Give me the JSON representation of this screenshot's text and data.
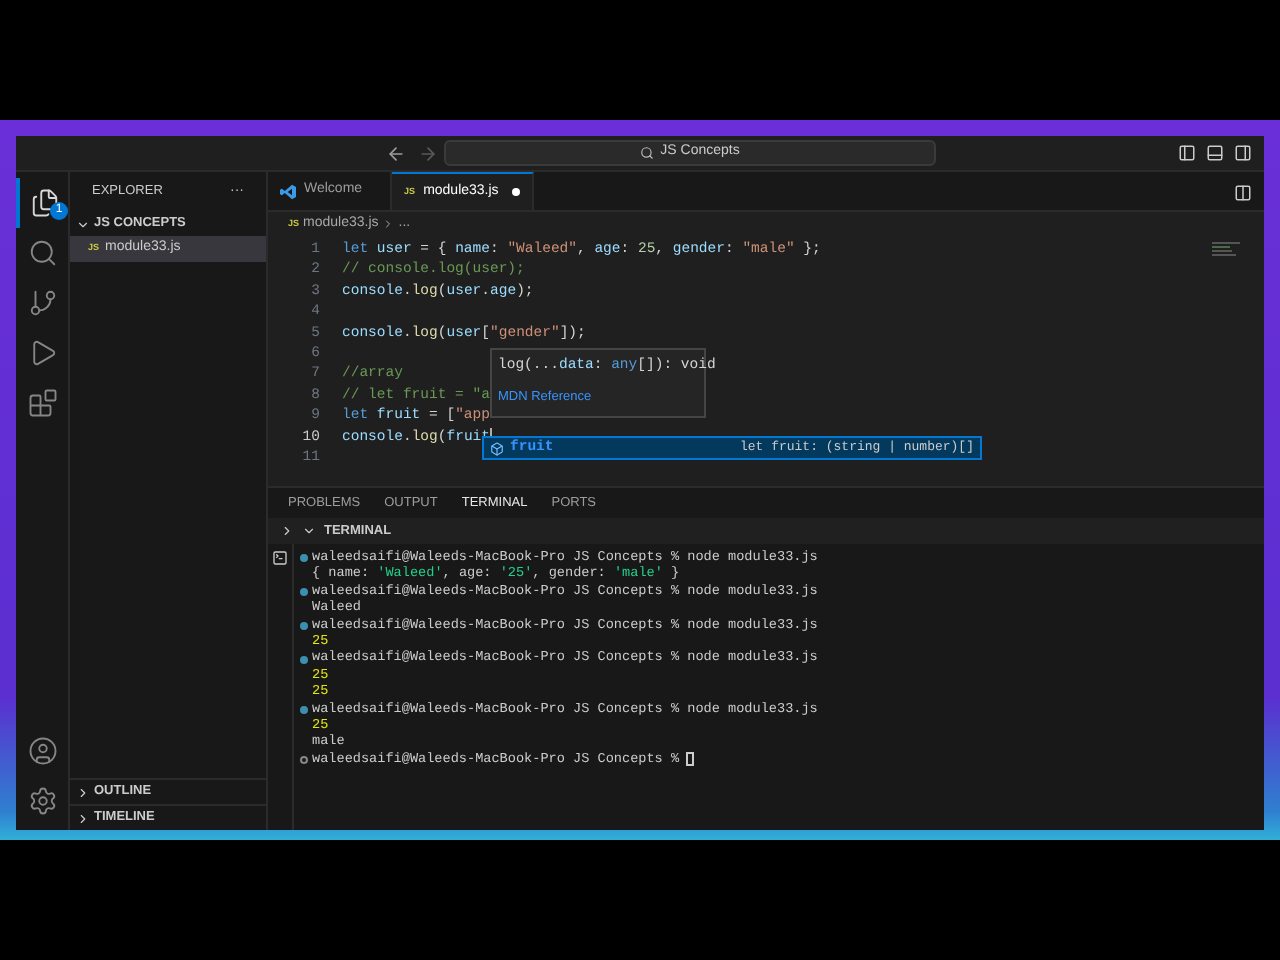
{
  "title_bar": {
    "search": "JS Concepts"
  },
  "activity_bar": {
    "badge": "1"
  },
  "sidebar": {
    "title": "EXPLORER",
    "more": "···",
    "folder": {
      "name": "JS CONCEPTS",
      "expanded": true,
      "files": [
        {
          "name": "module33.js",
          "badge": "JS",
          "selected": true
        }
      ]
    },
    "sections": [
      {
        "name": "OUTLINE",
        "expanded": false
      },
      {
        "name": "TIMELINE",
        "expanded": false
      }
    ]
  },
  "tabs": [
    {
      "label": "Welcome",
      "kind": "welcome",
      "selected": false,
      "modified": false
    },
    {
      "label": "module33.js",
      "kind": "js",
      "badge": "JS",
      "selected": true,
      "modified": true
    }
  ],
  "breadcrumb": {
    "badge": "JS",
    "file": "module33.js",
    "rest": "..."
  },
  "editor": {
    "lines": [
      {
        "number": "1",
        "current": false,
        "tokens": [
          {
            "text": "let ",
            "kind": "keyword"
          },
          {
            "text": "user",
            "kind": "variable"
          },
          {
            "text": " = { ",
            "kind": "plain"
          },
          {
            "text": "name",
            "kind": "property"
          },
          {
            "text": ": ",
            "kind": "plain"
          },
          {
            "text": "\"Waleed\"",
            "kind": "string"
          },
          {
            "text": ", ",
            "kind": "plain"
          },
          {
            "text": "age",
            "kind": "property"
          },
          {
            "text": ": ",
            "kind": "plain"
          },
          {
            "text": "25",
            "kind": "number"
          },
          {
            "text": ", ",
            "kind": "plain"
          },
          {
            "text": "gender",
            "kind": "property"
          },
          {
            "text": ": ",
            "kind": "plain"
          },
          {
            "text": "\"male\"",
            "kind": "string"
          },
          {
            "text": " };",
            "kind": "plain"
          }
        ]
      },
      {
        "number": "2",
        "current": false,
        "tokens": [
          {
            "text": "// console.log(user);",
            "kind": "comment"
          }
        ]
      },
      {
        "number": "3",
        "current": false,
        "tokens": [
          {
            "text": "console",
            "kind": "variable"
          },
          {
            "text": ".",
            "kind": "plain"
          },
          {
            "text": "log",
            "kind": "function"
          },
          {
            "text": "(",
            "kind": "plain"
          },
          {
            "text": "user",
            "kind": "variable"
          },
          {
            "text": ".",
            "kind": "plain"
          },
          {
            "text": "age",
            "kind": "property"
          },
          {
            "text": ");",
            "kind": "plain"
          }
        ]
      },
      {
        "number": "4",
        "current": false
      },
      {
        "number": "5",
        "current": false,
        "tokens": [
          {
            "text": "console",
            "kind": "variable"
          },
          {
            "text": ".",
            "kind": "plain"
          },
          {
            "text": "log",
            "kind": "function"
          },
          {
            "text": "(",
            "kind": "plain"
          },
          {
            "text": "user",
            "kind": "variable"
          },
          {
            "text": "[",
            "kind": "plain"
          },
          {
            "text": "\"gender\"",
            "kind": "string"
          },
          {
            "text": "]);",
            "kind": "plain"
          }
        ]
      },
      {
        "number": "6",
        "current": false
      },
      {
        "number": "7",
        "current": false,
        "tokens": [
          {
            "text": "//array",
            "kind": "comment"
          }
        ]
      },
      {
        "number": "8",
        "current": false,
        "tokens": [
          {
            "text": "// let fruit = \"a",
            "kind": "comment"
          }
        ]
      },
      {
        "number": "9",
        "current": false,
        "tokens": [
          {
            "text": "let ",
            "kind": "keyword"
          },
          {
            "text": "fruit",
            "kind": "variable"
          },
          {
            "text": " = [",
            "kind": "plain"
          },
          {
            "text": "\"app",
            "kind": "string"
          }
        ]
      },
      {
        "number": "10",
        "current": true,
        "tokens": [
          {
            "text": "console",
            "kind": "variable"
          },
          {
            "text": ".",
            "kind": "plain"
          },
          {
            "text": "log",
            "kind": "function"
          },
          {
            "text": "(",
            "kind": "plain"
          },
          {
            "text": "fruit",
            "kind": "variable"
          }
        ],
        "cursor": true
      },
      {
        "number": "11",
        "current": false
      }
    ]
  },
  "hover": {
    "signature": [
      {
        "text": "log(...",
        "kind": "plain"
      },
      {
        "text": "data",
        "kind": "variable"
      },
      {
        "text": ": ",
        "kind": "plain"
      },
      {
        "text": "any",
        "kind": "keyword"
      },
      {
        "text": "[]): void",
        "kind": "plain"
      }
    ],
    "link": "MDN Reference"
  },
  "suggestion": {
    "label": "fruit",
    "detail": "let fruit: (string | number)[]",
    "selected": true
  },
  "panel": {
    "tabs": [
      {
        "label": "PROBLEMS",
        "selected": false
      },
      {
        "label": "OUTPUT",
        "selected": false
      },
      {
        "label": "TERMINAL",
        "selected": true
      },
      {
        "label": "PORTS",
        "selected": false
      }
    ],
    "section": {
      "name": "TERMINAL",
      "expanded": true
    },
    "terminal_lines": [
      {
        "kind": "prompt",
        "text": "waleedsaifi@Waleeds-MacBook-Pro JS Concepts % node module33.js",
        "completed": true
      },
      {
        "kind": "output",
        "tokens": [
          {
            "text": "{ name: ",
            "kind": "plain"
          },
          {
            "text": "'Waleed'",
            "kind": "string"
          },
          {
            "text": ", age: ",
            "kind": "plain"
          },
          {
            "text": "'25'",
            "kind": "string"
          },
          {
            "text": ", gender: ",
            "kind": "plain"
          },
          {
            "text": "'male'",
            "kind": "string"
          },
          {
            "text": " }",
            "kind": "plain"
          }
        ]
      },
      {
        "kind": "prompt",
        "text": "waleedsaifi@Waleeds-MacBook-Pro JS Concepts % node module33.js",
        "completed": true
      },
      {
        "kind": "output",
        "tokens": [
          {
            "text": "Waleed",
            "kind": "plain"
          }
        ]
      },
      {
        "kind": "prompt",
        "text": "waleedsaifi@Waleeds-MacBook-Pro JS Concepts % node module33.js",
        "completed": true
      },
      {
        "kind": "output",
        "tokens": [
          {
            "text": "25",
            "kind": "number"
          }
        ]
      },
      {
        "kind": "prompt",
        "text": "waleedsaifi@Waleeds-MacBook-Pro JS Concepts % node module33.js",
        "completed": true
      },
      {
        "kind": "output",
        "tokens": [
          {
            "text": "25",
            "kind": "number"
          }
        ]
      },
      {
        "kind": "output",
        "tokens": [
          {
            "text": "25",
            "kind": "number"
          }
        ]
      },
      {
        "kind": "prompt",
        "text": "waleedsaifi@Waleeds-MacBook-Pro JS Concepts % node module33.js",
        "completed": true
      },
      {
        "kind": "output",
        "tokens": [
          {
            "text": "25",
            "kind": "number"
          }
        ]
      },
      {
        "kind": "output",
        "tokens": [
          {
            "text": "male",
            "kind": "plain"
          }
        ]
      },
      {
        "kind": "prompt",
        "text": "waleedsaifi@Waleeds-MacBook-Pro JS Concepts %",
        "completed": false,
        "cursor": true
      }
    ]
  }
}
